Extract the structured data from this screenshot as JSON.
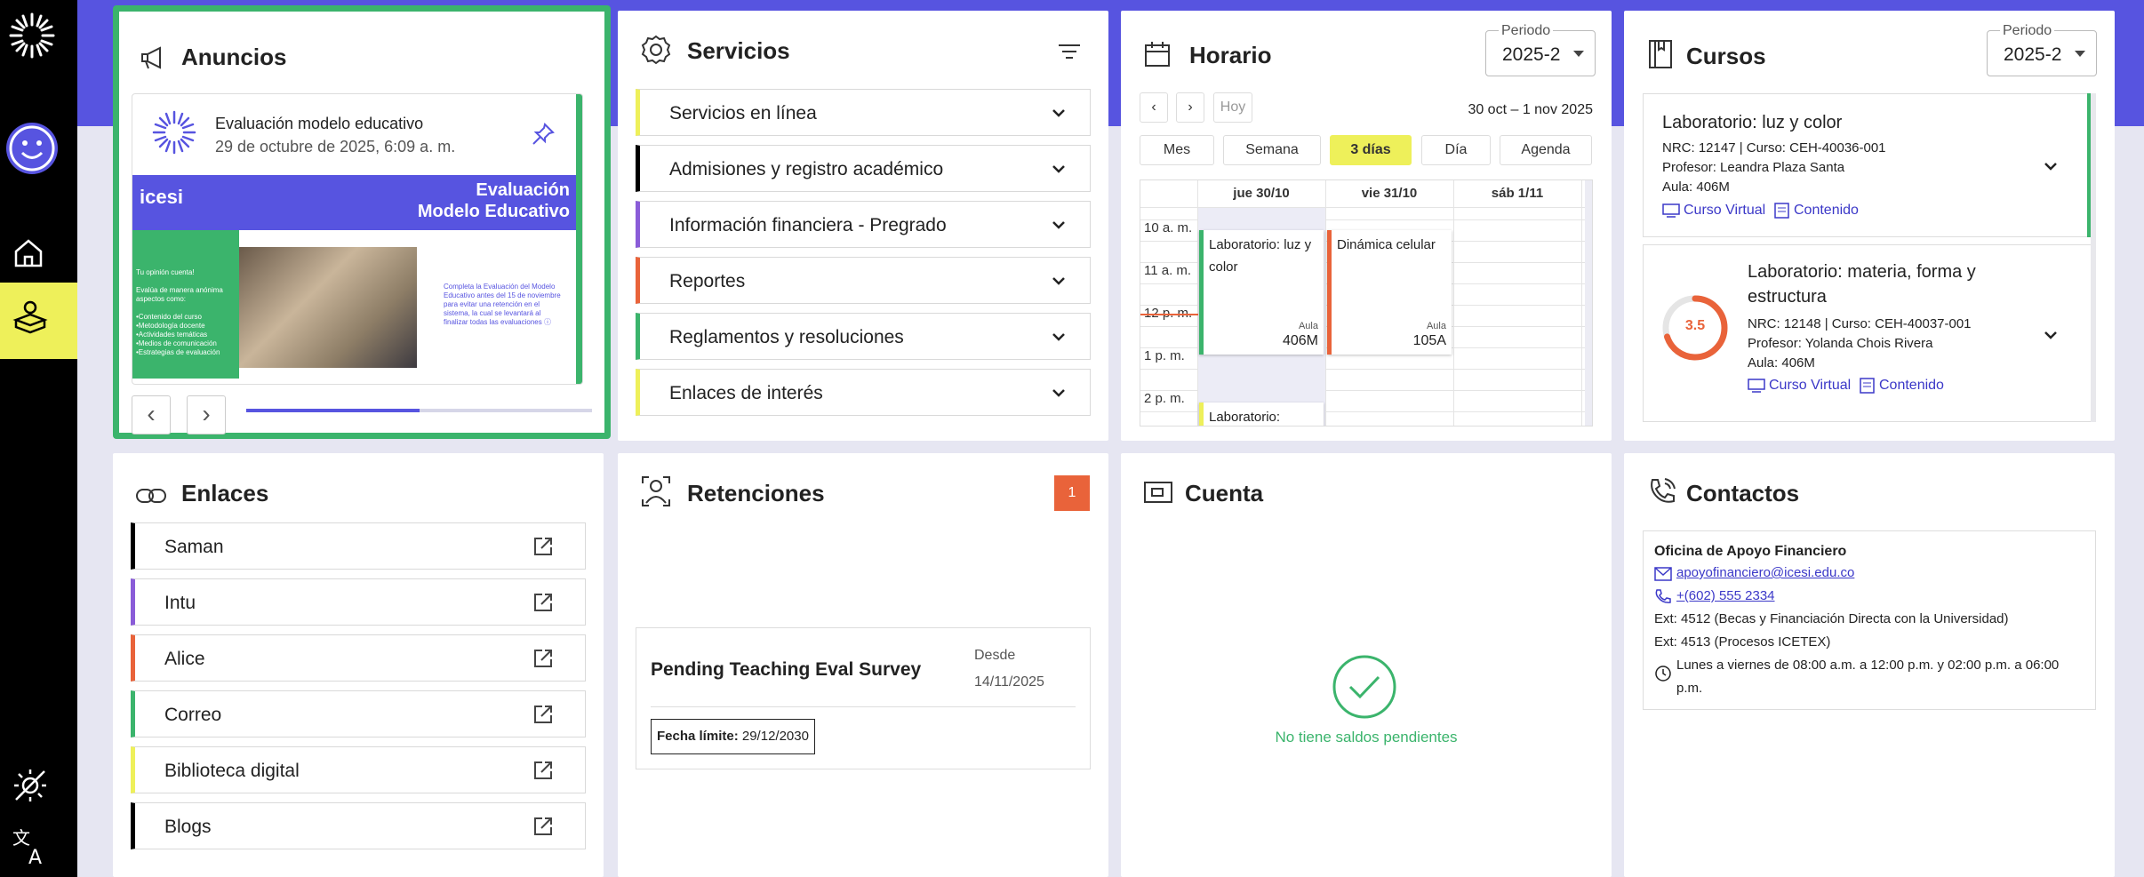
{
  "colors": {
    "brand": "#5754e0",
    "green": "#3bb46c",
    "yellow": "#eef05a",
    "orange": "#e9633a",
    "black": "#000000",
    "purple": "#8a5cd8"
  },
  "sidebar": {
    "icons": [
      "icesi-logo",
      "smiley-icon",
      "home-icon",
      "book-stack-icon",
      "theme-toggle-icon",
      "translate-icon"
    ],
    "active": "book-stack-icon"
  },
  "anuncios": {
    "title": "Anuncios",
    "item": {
      "title": "Evaluación modelo educativo",
      "date": "29 de octubre de 2025, 6:09 a. m."
    },
    "banner": {
      "logo_text": "icesi",
      "title_line1": "Evaluación",
      "title_line2": "Modelo Educativo",
      "left_text": [
        "Tu opinión cuenta!",
        "",
        "Evalúa de manera anónima",
        "aspectos como:",
        "",
        "•Contenido del curso",
        "•Metodología docente",
        "•Actividades temáticas",
        "•Medios de comunicación",
        "•Estrategias de evaluación"
      ],
      "right_text": "Completa la Evaluación del Modelo Educativo antes del 15 de noviembre para evitar una retención en el sistema, la cual se levantará al finalizar todas las evaluaciones ⓘ"
    },
    "carousel_progress": 0.5
  },
  "servicios": {
    "title": "Servicios",
    "items": [
      {
        "label": "Servicios en línea",
        "color": "#eef05a"
      },
      {
        "label": "Admisiones y registro académico",
        "color": "#000000"
      },
      {
        "label": "Información financiera - Pregrado",
        "color": "#8a5cd8"
      },
      {
        "label": "Reportes",
        "color": "#e9633a"
      },
      {
        "label": "Reglamentos y resoluciones",
        "color": "#3bb46c"
      },
      {
        "label": "Enlaces de interés",
        "color": "#eef05a"
      }
    ]
  },
  "horario": {
    "title": "Horario",
    "period_label": "Periodo",
    "period_value": "2025-2",
    "nav": {
      "prev": "‹",
      "next": "›",
      "today": "Hoy"
    },
    "range": "30 oct – 1 nov 2025",
    "views": [
      "Mes",
      "Semana",
      "3 días",
      "Día",
      "Agenda"
    ],
    "active_view": "3 días",
    "days": [
      "jue 30/10",
      "vie 31/10",
      "sáb 1/11"
    ],
    "times": [
      "10 a. m.",
      "11 a. m.",
      "12 p. m.",
      "1 p. m.",
      "2 p. m."
    ],
    "events": [
      {
        "title": "Laboratorio: luz y color",
        "aula_label": "Aula",
        "aula": "406M",
        "color": "#3bb46c"
      },
      {
        "title": "Dinámica celular",
        "aula_label": "Aula",
        "aula": "105A",
        "color": "#e9633a"
      },
      {
        "title": "Laboratorio:",
        "color": "#eef05a"
      }
    ]
  },
  "cursos": {
    "title": "Cursos",
    "period_label": "Periodo",
    "period_value": "2025-2",
    "items": [
      {
        "title": "Laboratorio: luz y color",
        "nrc": "NRC: 12147 | Curso: CEH-40036-001",
        "prof": "Profesor: Leandra Plaza Santa",
        "aula": "Aula: 406M",
        "link1": "Curso Virtual",
        "link2": "Contenido"
      },
      {
        "title_line1": "Laboratorio: materia, forma y",
        "title_line2": "estructura",
        "grade": "3.5",
        "grade_fraction": 0.7,
        "nrc": "NRC: 12148 | Curso: CEH-40037-001",
        "prof": "Profesor: Yolanda Chois Rivera",
        "aula": "Aula: 406M",
        "link1": "Curso Virtual",
        "link2": "Contenido"
      }
    ]
  },
  "enlaces": {
    "title": "Enlaces",
    "items": [
      {
        "label": "Saman",
        "color": "#000000"
      },
      {
        "label": "Intu",
        "color": "#8a5cd8"
      },
      {
        "label": "Alice",
        "color": "#e9633a"
      },
      {
        "label": "Correo",
        "color": "#3bb46c"
      },
      {
        "label": "Biblioteca digital",
        "color": "#eef05a"
      },
      {
        "label": "Blogs",
        "color": "#000000"
      }
    ]
  },
  "retenciones": {
    "title": "Retenciones",
    "count": "1",
    "item": {
      "name": "Pending Teaching Eval Survey",
      "since_label": "Desde",
      "since": "14/11/2025",
      "deadline_label": "Fecha límite:",
      "deadline": "29/12/2030"
    }
  },
  "cuenta": {
    "title": "Cuenta",
    "message": "No tiene saldos pendientes"
  },
  "contactos": {
    "title": "Contactos",
    "office": "Oficina de Apoyo Financiero",
    "email": "apoyofinanciero@icesi.edu.co",
    "phone": "+(602) 555 2334",
    "ext1": "Ext: 4512 (Becas y Financiación Directa con la Universidad)",
    "ext2": "Ext: 4513 (Procesos ICETEX)",
    "hours_line1": "Lunes a viernes de 08:00 a.m. a 12:00 p.m. y 02:00 p.m. a 06:00",
    "hours_line2": "p.m."
  }
}
